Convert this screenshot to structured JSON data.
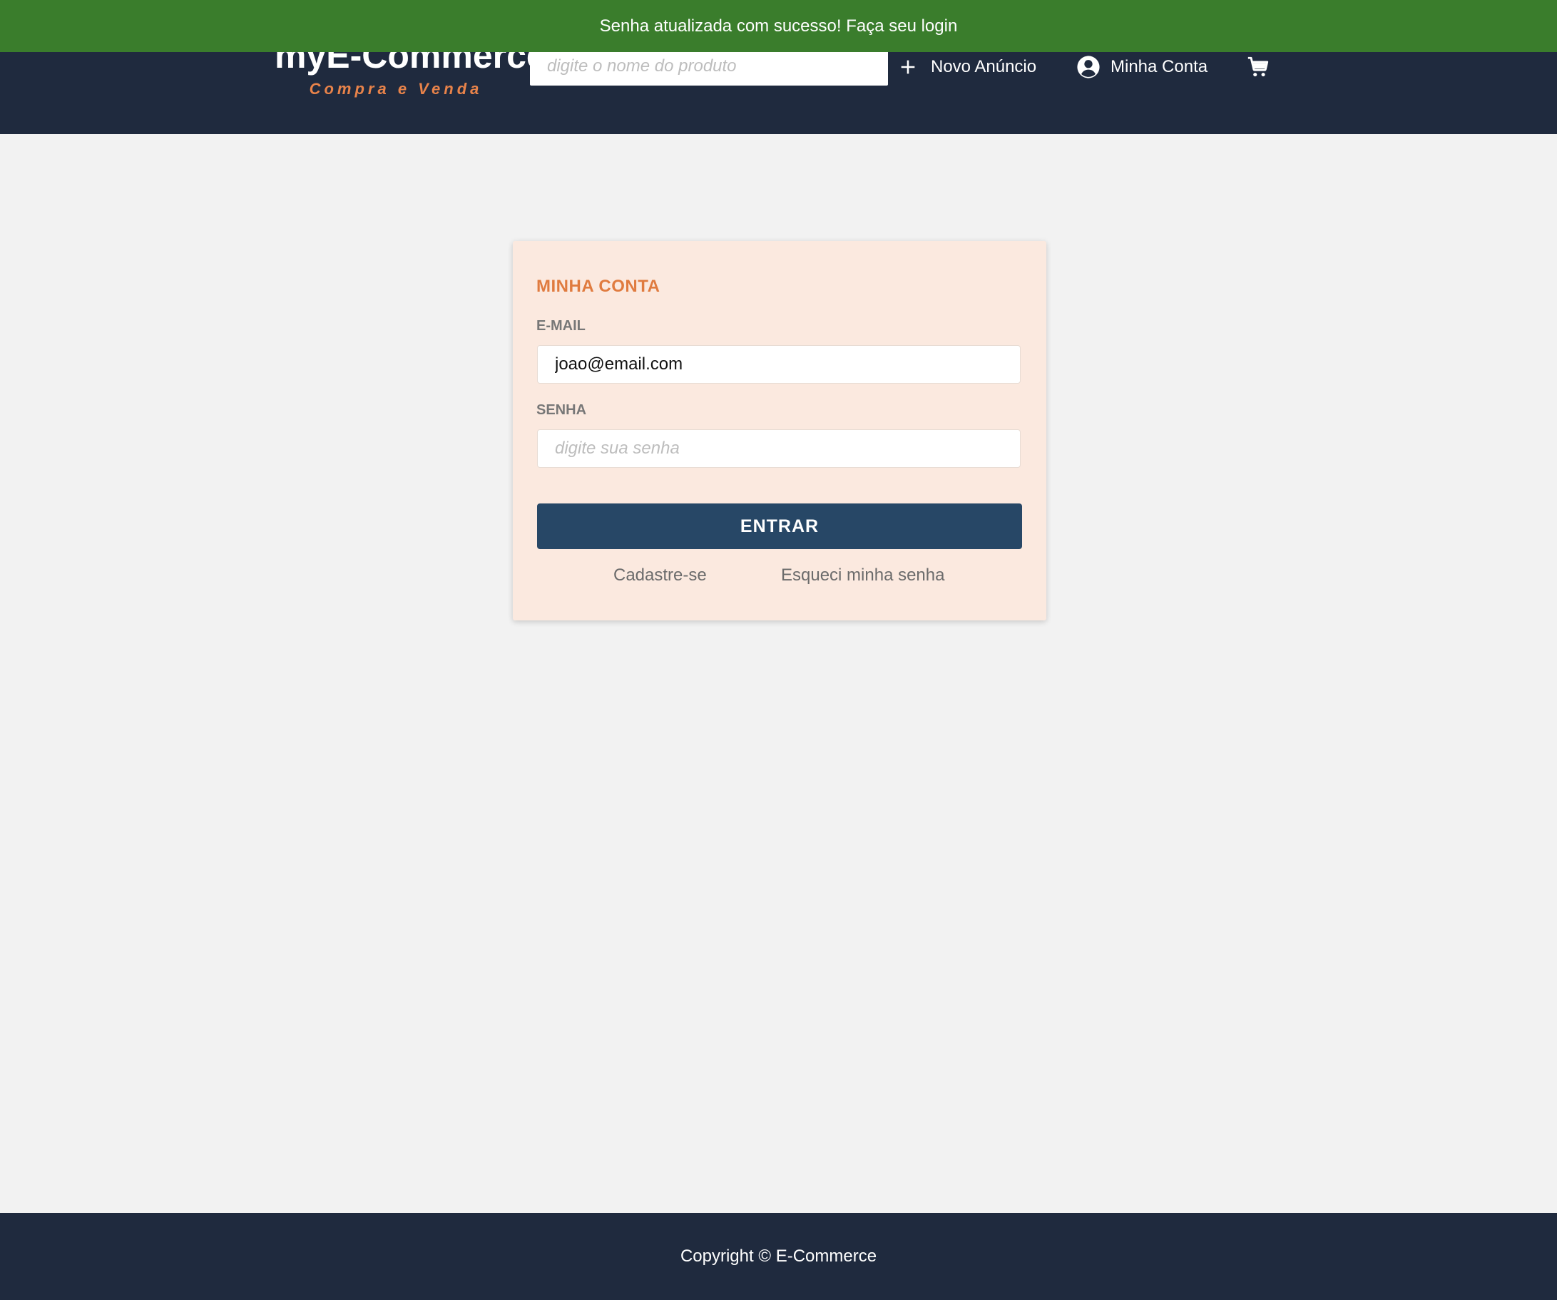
{
  "header": {
    "brand_title": "myE-Commerce",
    "brand_subtitle": "Compra e Venda",
    "search_placeholder": "digite o nome do produto",
    "nav": {
      "new_ad": "Novo Anúncio",
      "account": "Minha Conta"
    },
    "icons": [
      "plus-icon",
      "account-circle-icon",
      "cart-icon"
    ]
  },
  "toast": {
    "message": "Senha atualizada com sucesso! Faça seu login",
    "color": "#3a7d2c"
  },
  "login_card": {
    "title": "MINHA CONTA",
    "email_label": "E-MAIL",
    "email_value": "joao@email.com",
    "password_label": "SENHA",
    "password_placeholder": "digite sua senha",
    "submit_label": "ENTRAR",
    "signup_link": "Cadastre-se",
    "forgot_link": "Esqueci minha senha"
  },
  "footer": {
    "copyright": "Copyright © E-Commerce"
  },
  "colors": {
    "header_bg": "#1f2a3e",
    "accent": "#e07b3f",
    "button": "#274766",
    "card_bg": "#fbe9df"
  }
}
